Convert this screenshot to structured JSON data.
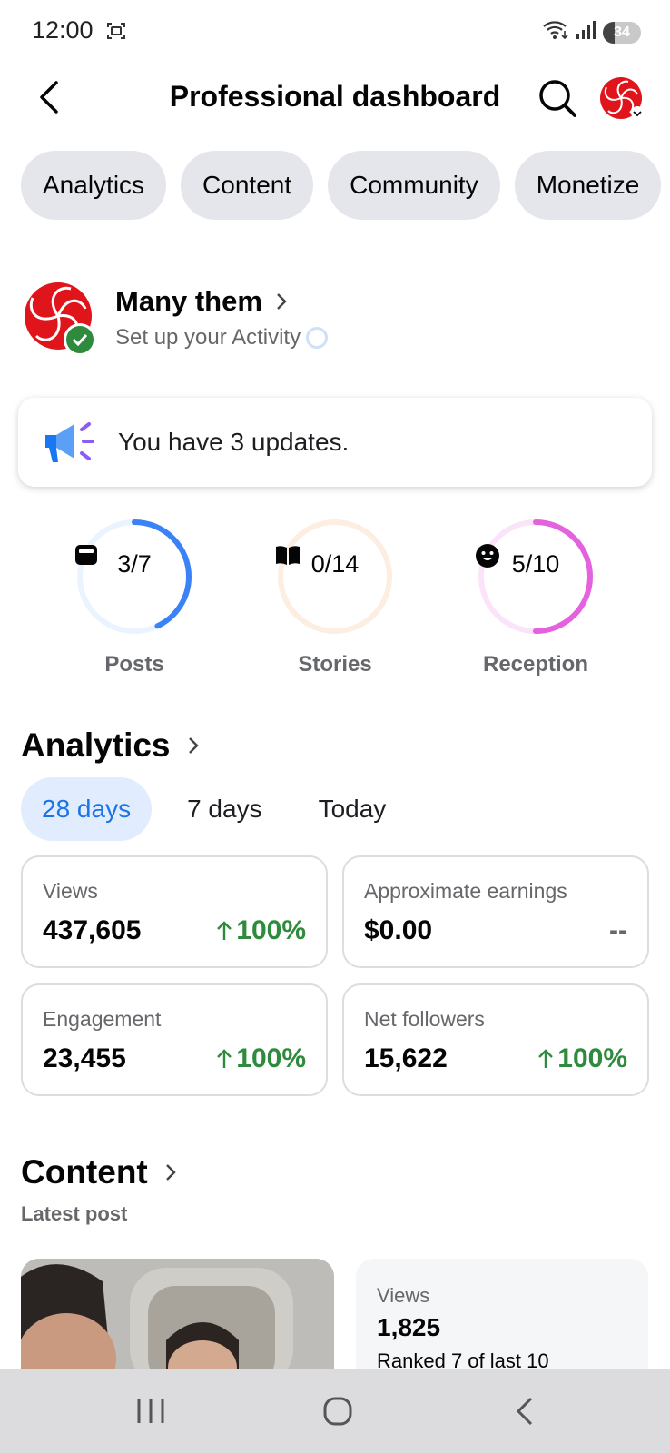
{
  "status_bar": {
    "time": "12:00",
    "battery": "34"
  },
  "header": {
    "title": "Professional dashboard"
  },
  "chips": [
    "Analytics",
    "Content",
    "Community",
    "Monetize"
  ],
  "profile": {
    "name": "Many them",
    "subtitle": "Set up your Activity"
  },
  "updates": {
    "text": "You have 3 updates."
  },
  "rings": [
    {
      "value": "3/7",
      "label": "Posts",
      "progress": 0.43,
      "color": "#3b82f6",
      "track": "#eaf3fe"
    },
    {
      "value": "0/14",
      "label": "Stories",
      "progress": 0.0,
      "color": "#f6a45a",
      "track": "#fdeee2"
    },
    {
      "value": "5/10",
      "label": "Reception",
      "progress": 0.5,
      "color": "#e462de",
      "track": "#fbe4fa"
    }
  ],
  "analytics": {
    "title": "Analytics",
    "ranges": [
      "28 days",
      "7 days",
      "Today"
    ],
    "active_range": "28 days",
    "cards": [
      {
        "label": "Views",
        "value": "437,605",
        "change": "100%"
      },
      {
        "label": "Approximate earnings",
        "value": "$0.00",
        "change": "--"
      },
      {
        "label": "Engagement",
        "value": "23,455",
        "change": "100%"
      },
      {
        "label": "Net followers",
        "value": "15,622",
        "change": "100%"
      }
    ]
  },
  "content": {
    "title": "Content",
    "latest_label": "Latest post",
    "post": {
      "views_label": "Views",
      "views_value": "1,825",
      "rank": "Ranked 7 of last 10"
    }
  },
  "colors": {
    "accent": "#1b74e4",
    "positive": "#2e8b3d",
    "brand_red": "#e0141b"
  }
}
